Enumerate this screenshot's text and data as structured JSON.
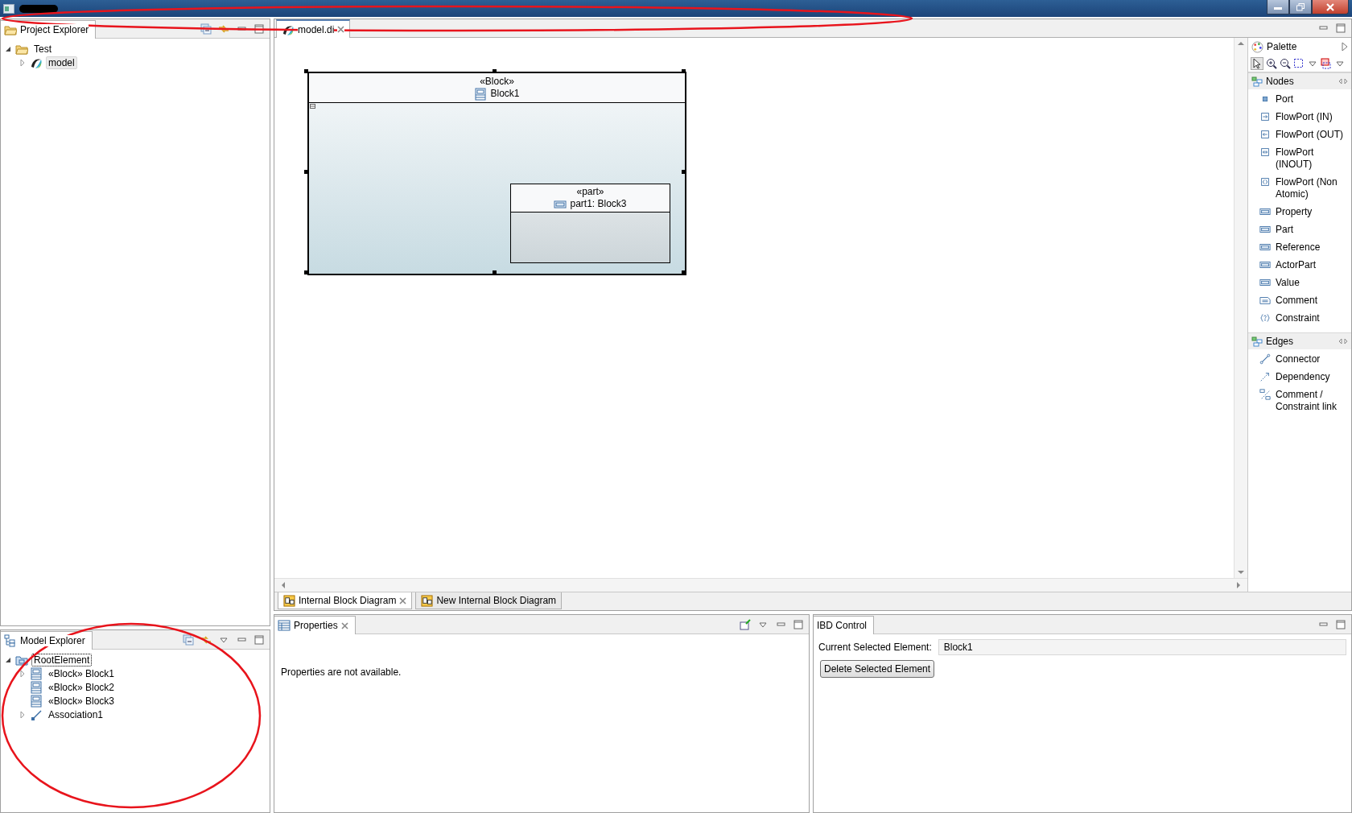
{
  "project_explorer": {
    "title": "Project Explorer",
    "tree": [
      {
        "label": "Test",
        "kind": "folder",
        "expandable": true,
        "expanded": true,
        "selected": false,
        "children": [
          {
            "label": "model",
            "kind": "model",
            "expandable": true,
            "expanded": false,
            "selected": true
          }
        ]
      }
    ]
  },
  "editor": {
    "tabs": [
      {
        "label": "model.di",
        "selected": true
      }
    ],
    "diagram": {
      "block": {
        "stereotype": "«Block»",
        "name": "Block1",
        "selected": true
      },
      "part": {
        "stereotype": "«part»",
        "name": "part1: Block3"
      }
    },
    "diagram_tabs": [
      {
        "label": "Internal Block Diagram",
        "selected": true
      },
      {
        "label": "New Internal Block Diagram",
        "selected": false
      }
    ]
  },
  "palette": {
    "title": "Palette",
    "drawers": [
      {
        "title": "Nodes",
        "items": [
          {
            "label": "Port",
            "kind": "port"
          },
          {
            "label": "FlowPort (IN)",
            "kind": "flow-in"
          },
          {
            "label": "FlowPort (OUT)",
            "kind": "flow-out"
          },
          {
            "label": "FlowPort (INOUT)",
            "kind": "flow-inout"
          },
          {
            "label": "FlowPort (Non Atomic)",
            "kind": "flow-nonatomic"
          },
          {
            "label": "Property",
            "kind": "property"
          },
          {
            "label": "Part",
            "kind": "property"
          },
          {
            "label": "Reference",
            "kind": "property"
          },
          {
            "label": "ActorPart",
            "kind": "property"
          },
          {
            "label": "Value",
            "kind": "property"
          },
          {
            "label": "Comment",
            "kind": "comment"
          },
          {
            "label": "Constraint",
            "kind": "constraint"
          }
        ]
      },
      {
        "title": "Edges",
        "items": [
          {
            "label": "Connector",
            "kind": "connector"
          },
          {
            "label": "Dependency",
            "kind": "dependency"
          },
          {
            "label": "Comment / Constraint link",
            "kind": "link"
          }
        ]
      }
    ]
  },
  "model_explorer": {
    "title": "Model Explorer",
    "tree": [
      {
        "label": "RootElement",
        "kind": "package",
        "expandable": true,
        "expanded": true,
        "selected": true,
        "children": [
          {
            "label": "«Block» Block1",
            "kind": "block",
            "expandable": true,
            "expanded": false,
            "selected": false
          },
          {
            "label": "«Block» Block2",
            "kind": "block",
            "expandable": false,
            "selected": false
          },
          {
            "label": "«Block» Block3",
            "kind": "block",
            "expandable": false,
            "selected": false
          },
          {
            "label": "Association1",
            "kind": "association",
            "expandable": true,
            "expanded": false,
            "selected": false
          }
        ]
      }
    ]
  },
  "properties": {
    "title": "Properties",
    "message": "Properties are not available."
  },
  "ibd_control": {
    "title": "IBD Control",
    "field_label": "Current Selected Element:",
    "field_value": "Block1",
    "button": "Delete Selected Element"
  }
}
